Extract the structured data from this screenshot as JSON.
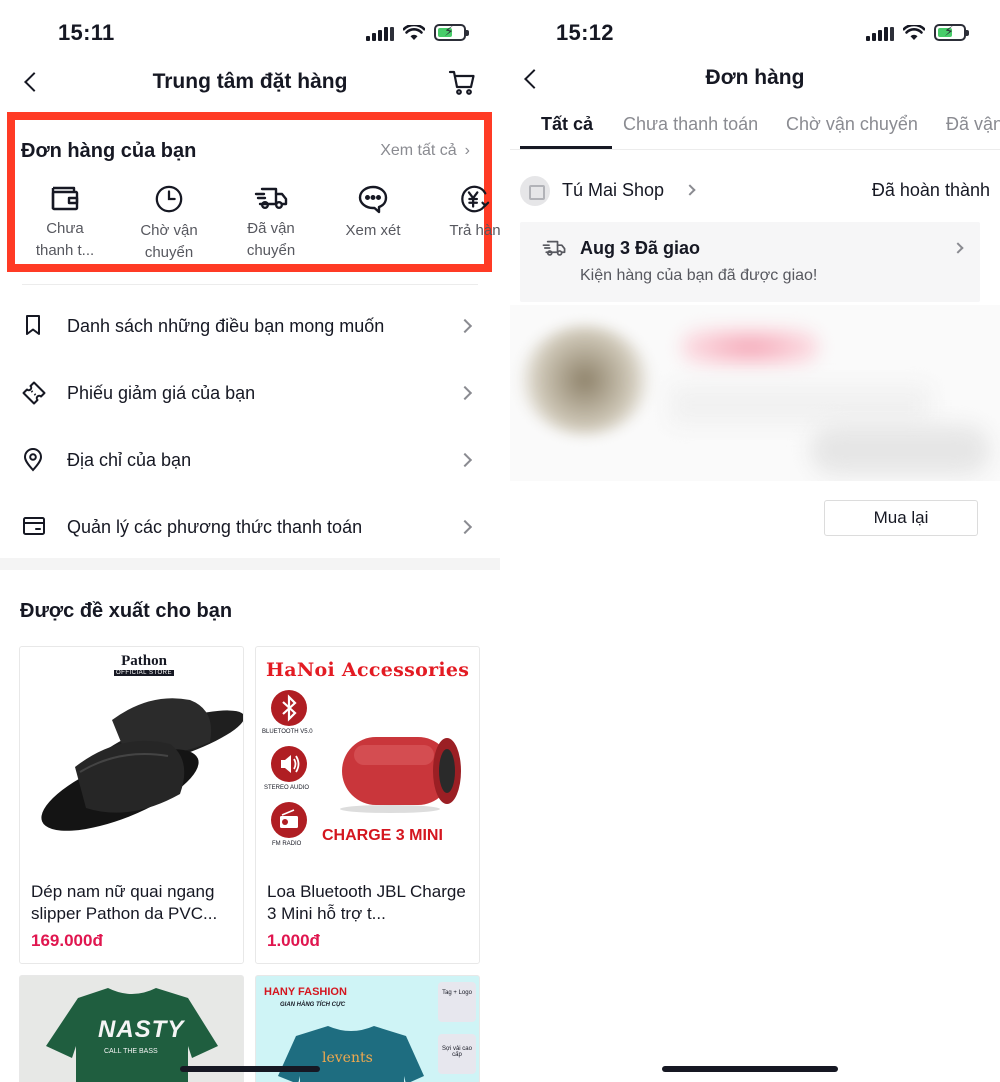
{
  "left": {
    "status": {
      "time": "15:11"
    },
    "header": {
      "title": "Trung tâm đặt hàng"
    },
    "orders": {
      "title": "Đơn hàng của bạn",
      "see_all": "Xem tất cả",
      "items": [
        {
          "label_line1": "Chưa",
          "label_line2": "thanh t...",
          "icon": "wallet-icon"
        },
        {
          "label_line1": "Chờ vận",
          "label_line2": "chuyển",
          "icon": "clock-icon"
        },
        {
          "label_line1": "Đã vận",
          "label_line2": "chuyển",
          "icon": "truck-icon"
        },
        {
          "label_line1": "Xem xét",
          "label_line2": "",
          "icon": "review-icon"
        },
        {
          "label_line1": "Trả hàn",
          "label_line2": "",
          "icon": "refund-icon"
        }
      ],
      "highlight_color": "#ff3b25"
    },
    "menu": [
      {
        "label": "Danh sách những điều bạn mong muốn",
        "icon": "bookmark-icon"
      },
      {
        "label": "Phiếu giảm giá của bạn",
        "icon": "coupon-icon"
      },
      {
        "label": "Địa chỉ của bạn",
        "icon": "location-icon"
      },
      {
        "label": "Quản lý các phương thức thanh toán",
        "icon": "card-icon"
      }
    ],
    "recommend": {
      "title": "Được đề xuất cho bạn",
      "products": [
        {
          "name": "Dép nam nữ quai ngang slipper Pathon da PVC...",
          "price": "169.000đ",
          "brand": "Pathon",
          "brand_sub": "OFFICIAL STORE"
        },
        {
          "name": "Loa Bluetooth JBL Charge 3 Mini hỗ trợ t...",
          "price": "1.000đ",
          "brand": "HaNoi Accessories",
          "tag1": "BLUETOOTH V5.0",
          "tag2": "STEREO AUDIO",
          "tag3": "FM RADIO",
          "model": "CHARGE 3 MINI"
        },
        {
          "brand": "NASTY",
          "brand_sub": "CALL THE BASS"
        },
        {
          "brand": "HANY FASHION",
          "brand_sub": "GIAN HÀNG TÍCH CỰC",
          "shirt_text": "levents",
          "side1": "Tag + Logo",
          "side2": "Sợi vải cao cấp"
        }
      ]
    },
    "price_color": "#e0164f"
  },
  "right": {
    "status": {
      "time": "15:12"
    },
    "header": {
      "title": "Đơn hàng"
    },
    "tabs": [
      "Tất cả",
      "Chưa thanh toán",
      "Chờ vận chuyển",
      "Đã vận"
    ],
    "active_tab": "Tất cả",
    "shop": {
      "name": "Tú Mai Shop",
      "status": "Đã hoàn thành"
    },
    "delivery": {
      "title": "Aug 3 Đã giao",
      "subtitle": "Kiện hàng của bạn đã được giao!"
    },
    "rebuy_label": "Mua lại"
  }
}
